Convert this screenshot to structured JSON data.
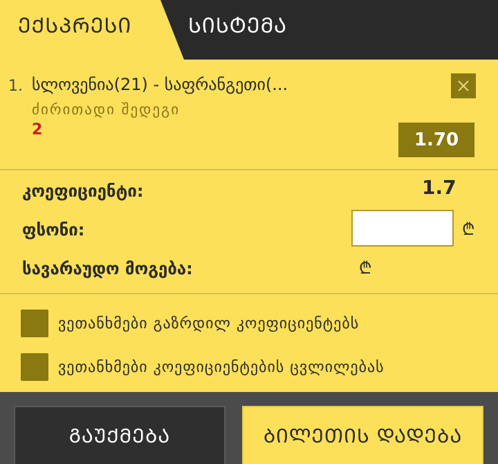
{
  "tabs": [
    {
      "label": "ᲔᲥᲡᲞᲠᲔᲡᲘ",
      "active": true
    },
    {
      "label": "ᲡᲘᲡᲢᲔᲛᲐ",
      "active": false
    }
  ],
  "bet": {
    "number": "1.",
    "event": "სლოვენია(21) - საფრანგეთი(...",
    "market": "ძირითადი შედეგი",
    "outcome": "2",
    "odds": "1.70",
    "remove_icon": "close-icon"
  },
  "summary": {
    "coef_label": "კოეფიციენტი:",
    "coef_value": "1.7",
    "stake_label": "ფსონი:",
    "stake_value": "",
    "win_label": "სავარაუდო მოგება:",
    "currency_symbol": "₾"
  },
  "options": [
    {
      "label": "ვეთანხმები გაზრდილ კოეფიციენტებს",
      "checked": false
    },
    {
      "label": "ვეთანხმები კოეფიციენტების ცვლილებას",
      "checked": false
    }
  ],
  "footer": {
    "clear_label": "ᲒᲐᲣᲥᲛᲔᲑᲐ",
    "place_label": "ᲑᲘᲚᲔᲗᲘᲡ ᲓᲐᲓᲔᲑᲐ"
  },
  "colors": {
    "background": "#fce05a",
    "dark": "#2a2a2a",
    "accent_dark": "#8a7810",
    "outcome_red": "#c0231b",
    "footer": "#4b4b4b"
  }
}
